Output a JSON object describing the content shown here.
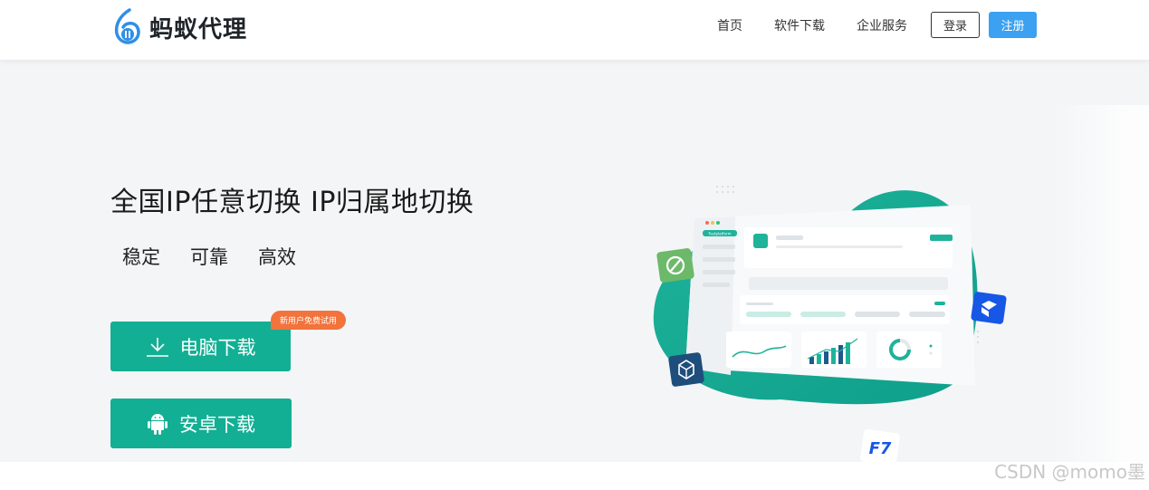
{
  "brand": {
    "name": "蚂蚁代理",
    "color": "#3ba1f0"
  },
  "nav": {
    "items": [
      {
        "label": "首页"
      },
      {
        "label": "软件下载"
      },
      {
        "label": "企业服务"
      }
    ],
    "login_label": "登录",
    "register_label": "注册"
  },
  "hero": {
    "title": "全国IP任意切换 IP归属地切换",
    "features": [
      "稳定",
      "可靠",
      "高效"
    ],
    "pc_download_label": "电脑下载",
    "promo_badge": "新用户免费试用",
    "android_download_label": "安卓下载",
    "accent_color": "#12af94"
  },
  "illustration": {
    "panel_tag": "Fastplatform",
    "icons": [
      "leaf-app-icon",
      "box-app-icon",
      "cube-app-icon",
      "f7-app-icon"
    ]
  },
  "watermark": "CSDN @momo墨"
}
